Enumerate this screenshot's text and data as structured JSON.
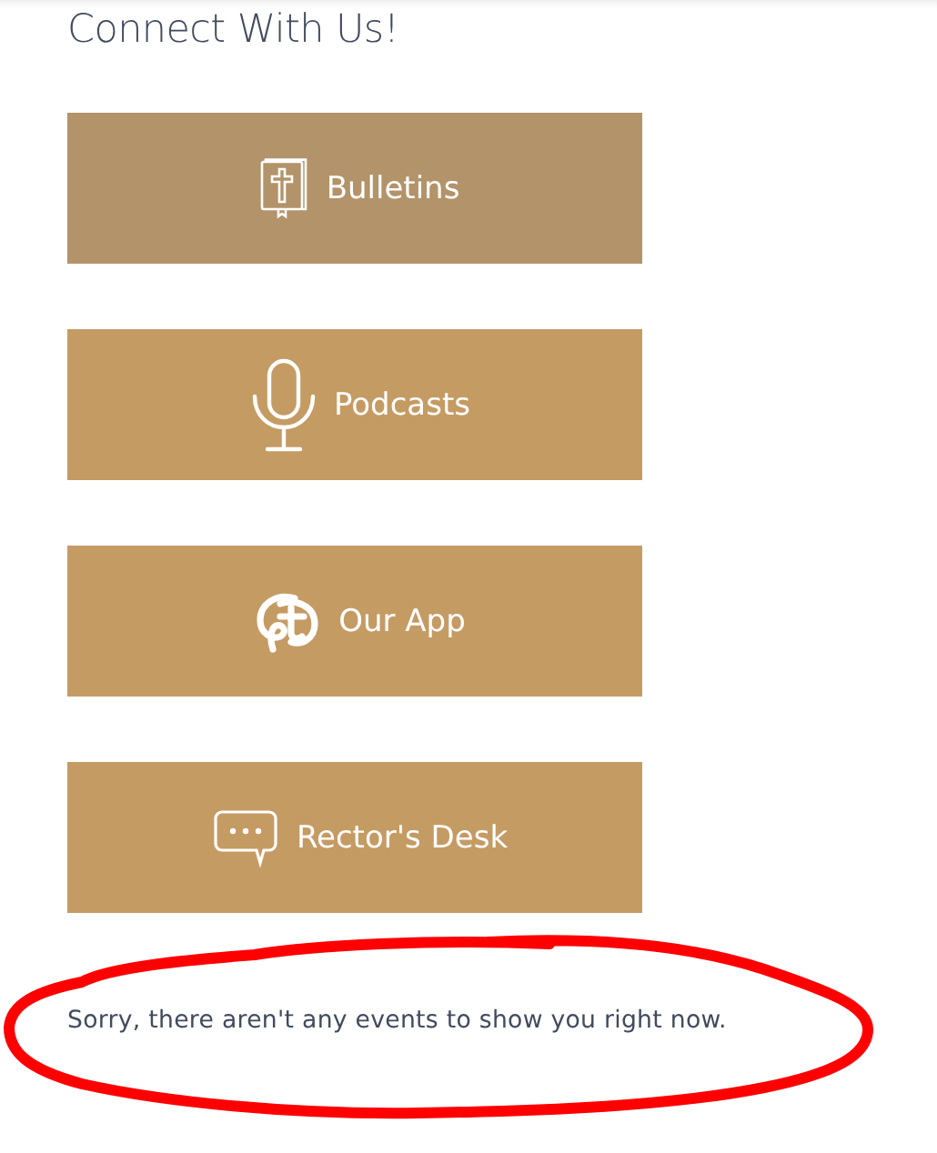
{
  "heading": "Connect With Us!",
  "links": [
    {
      "label": "Bulletins",
      "kind": "bible",
      "highlighted": true
    },
    {
      "label": "Podcasts",
      "kind": "microphone",
      "highlighted": false
    },
    {
      "label": "Our App",
      "kind": "app",
      "highlighted": false
    },
    {
      "label": "Rector's Desk",
      "kind": "chat",
      "highlighted": false
    }
  ],
  "events_message": "Sorry, there aren't any events to show you right now.",
  "annotation": {
    "kind": "ellipse",
    "color": "#ff0000"
  }
}
